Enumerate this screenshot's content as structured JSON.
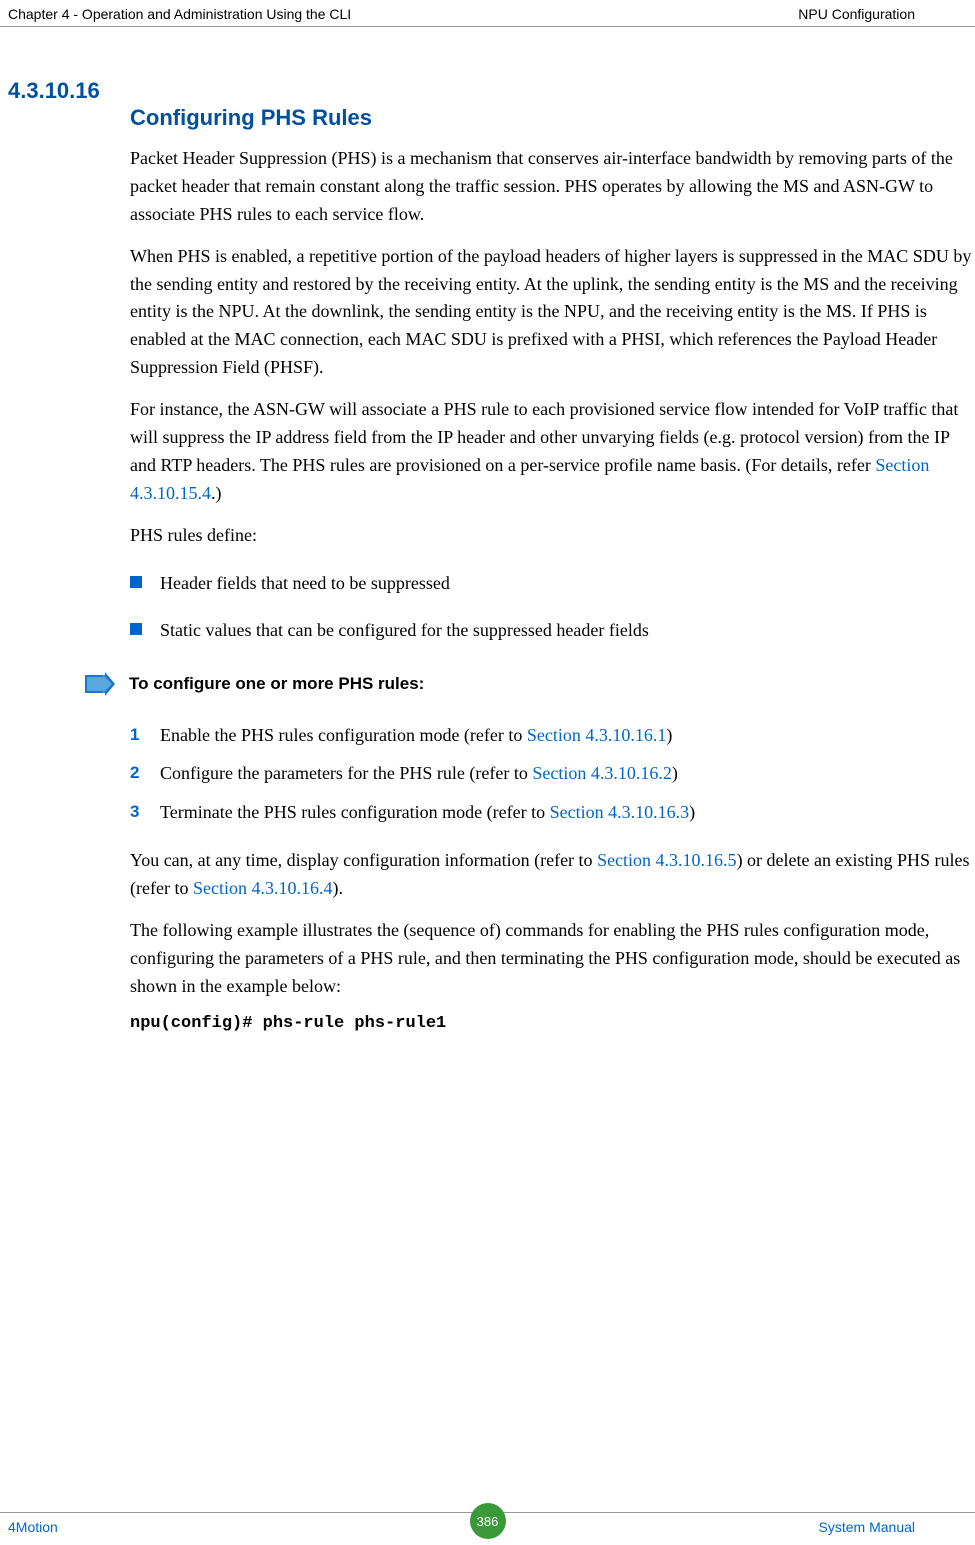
{
  "header": {
    "left": "Chapter 4 - Operation and Administration Using the CLI",
    "right": "NPU Configuration"
  },
  "section": {
    "number": "4.3.10.16",
    "title": "Configuring PHS Rules"
  },
  "paragraphs": {
    "p1": "Packet Header Suppression (PHS) is a mechanism that conserves air-interface bandwidth by removing parts of the packet header that remain constant along the traffic session. PHS operates by allowing the MS and ASN-GW to associate PHS rules to each service flow.",
    "p2": "When PHS is enabled, a repetitive portion of the payload headers of higher layers is suppressed in the MAC SDU by the sending entity and restored by the receiving entity. At the uplink, the sending entity is the MS and the receiving entity is the NPU. At the downlink, the sending entity is the NPU, and the receiving entity is the MS. If PHS is enabled at the MAC connection, each MAC SDU is prefixed with a PHSI, which references the Payload Header Suppression Field (PHSF).",
    "p3a": "For instance, the ASN-GW will associate a PHS rule to each provisioned service flow intended for VoIP traffic that will suppress the IP address field from the IP header and other unvarying fields (e.g. protocol version) from the IP and RTP headers. The PHS rules are provisioned on a per-service profile name basis. (For details, refer ",
    "p3link": "Section 4.3.10.15.4",
    "p3b": ".)",
    "p4": "PHS rules define:",
    "bullets": [
      "Header fields that need to be suppressed",
      "Static values that can be configured for the suppressed header fields"
    ],
    "procHeading": "To configure one or more PHS rules:",
    "steps": [
      {
        "text": "Enable the PHS rules configuration mode (refer to ",
        "link": "Section 4.3.10.16.1",
        "tail": ")"
      },
      {
        "text": "Configure the parameters for the PHS rule (refer to ",
        "link": "Section 4.3.10.16.2",
        "tail": ")"
      },
      {
        "text": "Terminate the PHS rules configuration mode (refer to ",
        "link": "Section 4.3.10.16.3",
        "tail": ")"
      }
    ],
    "p5a": "You can, at any time, display configuration information (refer to ",
    "p5link1": "Section 4.3.10.16.5",
    "p5mid": ") or delete an existing PHS rules (refer to ",
    "p5link2": "Section 4.3.10.16.4",
    "p5b": ").",
    "p6": "The following example illustrates the (sequence of) commands for enabling the PHS rules configuration mode, configuring the parameters of a PHS rule, and then terminating the PHS configuration mode, should be executed as shown in the example below:",
    "code": "npu(config)# phs-rule phs-rule1"
  },
  "footer": {
    "left": "4Motion",
    "page": "386",
    "right": "System Manual"
  }
}
